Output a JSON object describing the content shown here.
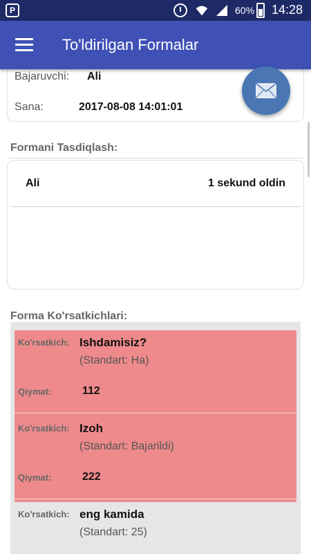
{
  "status_bar": {
    "app_icon": "P",
    "battery_percent": "60%",
    "time": "14:28",
    "icons": [
      "alarm-icon",
      "wifi-icon",
      "signal-icon",
      "battery-icon"
    ]
  },
  "app_bar": {
    "title": "To'ldirilgan Formalar",
    "menu_icon": "hamburger-menu-icon",
    "color": "#3f51b5"
  },
  "info_card": {
    "executor_label": "Bajaruvchi:",
    "executor_value": "Ali",
    "date_label": "Sana:",
    "date_value": "2017-08-08 14:01:01"
  },
  "fab": {
    "icon": "mail-icon",
    "color": "#4a77b4"
  },
  "approval": {
    "section_title": "Formani Tasdiqlash:",
    "name": "Ali",
    "time_ago": "1 sekund oldin"
  },
  "indicators": {
    "section_title": "Forma Ko'rsatkichlari:",
    "highlight_color": "#ee8a8b",
    "items": [
      {
        "indicator_label": "Ko'rsatkich:",
        "name": "Ishdamisiz?",
        "standard": "(Standart:  Ha)",
        "value_label": "Qiymat:",
        "value": "112"
      },
      {
        "indicator_label": "Ko'rsatkich:",
        "name": "Izoh",
        "standard": "(Standart:  Bajarildi)",
        "value_label": "Qiymat:",
        "value": "222"
      },
      {
        "indicator_label": "Ko'rsatkich:",
        "name": "eng kamida",
        "standard": "(Standart:  25)"
      }
    ]
  }
}
